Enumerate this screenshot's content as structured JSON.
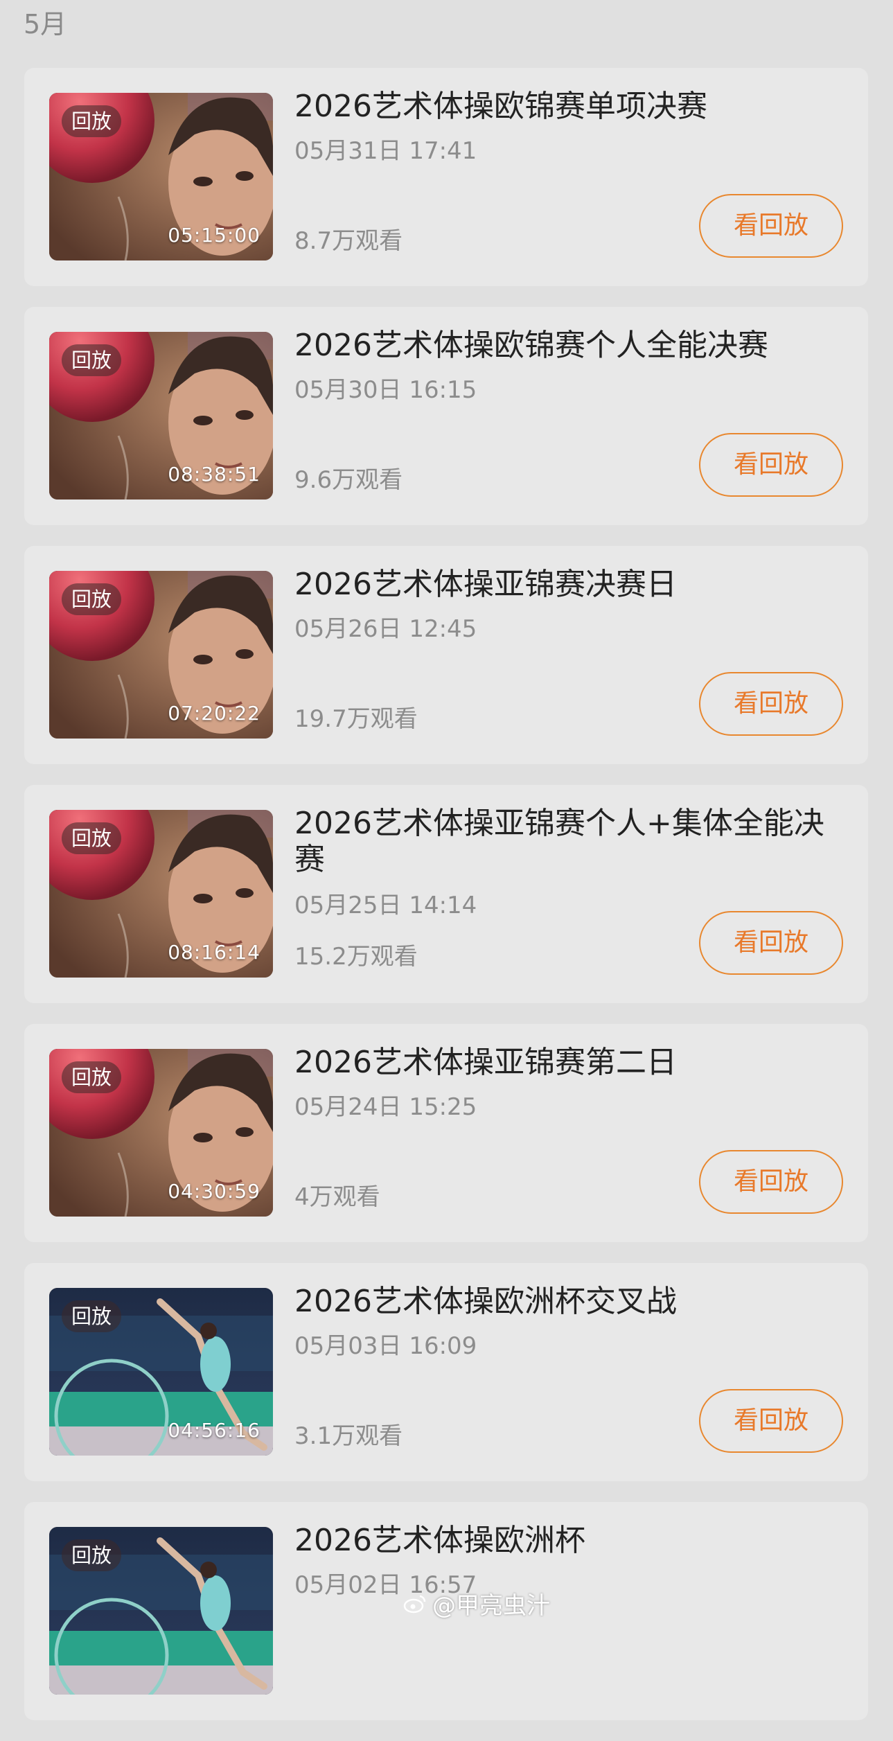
{
  "section": {
    "month": "5月"
  },
  "items": [
    {
      "badge": "回放",
      "duration": "05:15:00",
      "title": "2026艺术体操欧锦赛单项决赛",
      "date": "05月31日 17:41",
      "views": "8.7万观看",
      "button": "看回放",
      "thumb": "ball-close-up"
    },
    {
      "badge": "回放",
      "duration": "08:38:51",
      "title": "2026艺术体操欧锦赛个人全能决赛",
      "date": "05月30日 16:15",
      "views": "9.6万观看",
      "button": "看回放",
      "thumb": "ball-close-up"
    },
    {
      "badge": "回放",
      "duration": "07:20:22",
      "title": "2026艺术体操亚锦赛决赛日",
      "date": "05月26日 12:45",
      "views": "19.7万观看",
      "button": "看回放",
      "thumb": "ball-close-up"
    },
    {
      "badge": "回放",
      "duration": "08:16:14",
      "title": "2026艺术体操亚锦赛个人+集体全能决赛",
      "date": "05月25日 14:14",
      "views": "15.2万观看",
      "button": "看回放",
      "thumb": "ball-close-up"
    },
    {
      "badge": "回放",
      "duration": "04:30:59",
      "title": "2026艺术体操亚锦赛第二日",
      "date": "05月24日 15:25",
      "views": "4万观看",
      "button": "看回放",
      "thumb": "ball-close-up"
    },
    {
      "badge": "回放",
      "duration": "04:56:16",
      "title": "2026艺术体操欧洲杯交叉战",
      "date": "05月03日 16:09",
      "views": "3.1万观看",
      "button": "看回放",
      "thumb": "hoop-arena"
    },
    {
      "badge": "回放",
      "duration": "",
      "title": "2026艺术体操欧洲杯",
      "date": "05月02日 16:57",
      "views": "",
      "button": "",
      "thumb": "hoop-arena"
    }
  ],
  "watermark": {
    "text": "@甲亮虫汁"
  },
  "colors": {
    "accent": "#e8792a",
    "card": "#e8e8e8",
    "background": "#e0e0e0",
    "muted": "#8c8c8c"
  }
}
